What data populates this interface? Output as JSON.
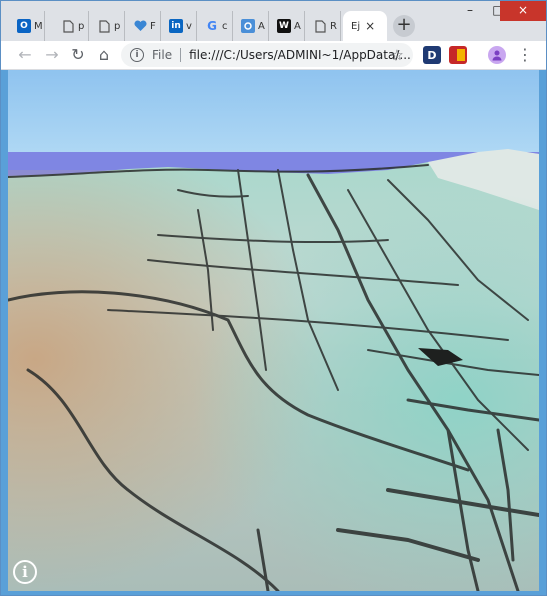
{
  "tabs": [
    {
      "favicon": "O",
      "label": "M",
      "icon": "outlook-icon"
    },
    {
      "favicon": "",
      "label": "p",
      "icon": "document-icon"
    },
    {
      "favicon": "",
      "label": "p",
      "icon": "document-icon"
    },
    {
      "favicon": "",
      "label": "F",
      "icon": "heart-pulse-icon"
    },
    {
      "favicon": "in",
      "label": "v",
      "icon": "linkedin-icon"
    },
    {
      "favicon": "G",
      "label": "c",
      "icon": "google-icon"
    },
    {
      "favicon": "",
      "label": "A",
      "icon": "app-icon"
    },
    {
      "favicon": "W",
      "label": "A",
      "icon": "wikipedia-icon"
    },
    {
      "favicon": "",
      "label": "R",
      "icon": "document-icon"
    },
    {
      "favicon": "",
      "label": "Ej",
      "icon": "none"
    }
  ],
  "active_tab_close": "×",
  "new_tab": "+",
  "window_controls": {
    "minimize": "–",
    "maximize": "□",
    "close": "×"
  },
  "nav": {
    "back": "←",
    "forward": "→",
    "reload": "↻",
    "home": "⌂"
  },
  "address": {
    "info": "i",
    "scheme": "File",
    "url": "file:///C:/Users/ADMINI~1/AppData/..."
  },
  "star": "☆",
  "extensions": [
    {
      "label": "D",
      "icon": "dashlane-icon"
    },
    {
      "label": "",
      "icon": "red-extension-icon"
    }
  ],
  "menu": "⋮",
  "viewer_info": "i",
  "colors": {
    "titlebar": "#dee1e6",
    "sky_top": "#8fc3ef",
    "sky_bottom": "#b5dcf5",
    "water": "#7f86e3",
    "terrain_light": "#c9ddd8",
    "terrain_teal": "#8fcfc0",
    "terrain_sand": "#c8a785",
    "roads": "#2a2d2c"
  }
}
